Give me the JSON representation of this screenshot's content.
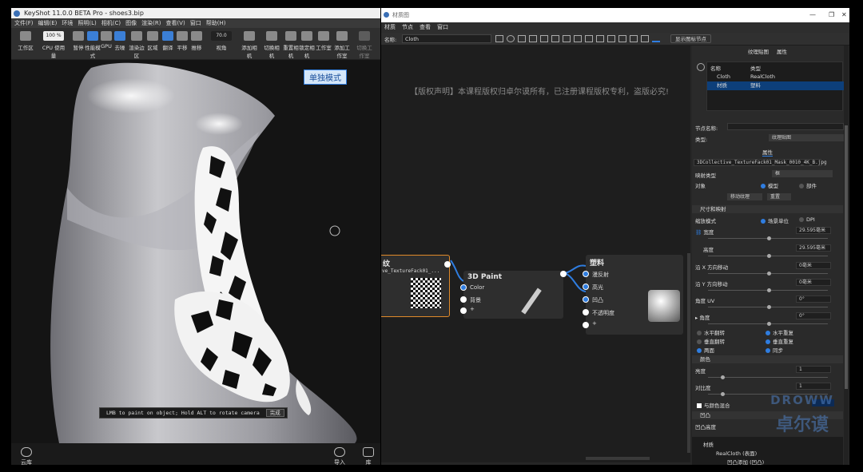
{
  "left_window": {
    "title": "KeyShot 11.0.0 BETA Pro - shoes3.bip",
    "menu": [
      "文件(F)",
      "编辑(E)",
      "环境",
      "照明(L)",
      "相机(C)",
      "图像",
      "渲染(R)",
      "查看(V)",
      "窗口",
      "帮助(H)"
    ],
    "tools": [
      {
        "label": "工作区",
        "value": ""
      },
      {
        "label": "CPU 使用量",
        "value": "100 %"
      },
      {
        "label": "暂停"
      },
      {
        "label": "性能模式"
      },
      {
        "label": "GPU"
      },
      {
        "label": "去噪"
      },
      {
        "label": "渲染边区"
      },
      {
        "label": "区域"
      },
      {
        "label": "翻译"
      },
      {
        "label": "平移"
      },
      {
        "label": "推移"
      },
      {
        "label": "视角",
        "value": "70.0"
      },
      {
        "label": "添加相机"
      },
      {
        "label": "切换相机"
      },
      {
        "label": "重置相机"
      },
      {
        "label": "锁定相机"
      },
      {
        "label": "工作室"
      },
      {
        "label": "添加工作室"
      },
      {
        "label": "切换工作室"
      }
    ],
    "mode_badge": "单独模式",
    "paint_hint": "LMB to paint on object; Hold ALT to rotate camera",
    "paint_done": "完成",
    "bottom": {
      "cloud": "云库",
      "import": "导入",
      "library": "库"
    }
  },
  "right_window": {
    "title": "材质图",
    "menu": [
      "材质",
      "节点",
      "查看",
      "窗口"
    ],
    "name_label": "名称:",
    "name_value": "Cloth",
    "show_node_btn": "显示图标节点",
    "copyright": "【版权声明】本课程版权归卓尔谟所有，已注册课程版权专利，盗版必究!",
    "nodes": {
      "texture": {
        "title": "纹",
        "file": "ve_TextureFack01_..."
      },
      "paint": {
        "title": "3D Paint",
        "inputs": [
          "Color",
          "背景",
          "+"
        ]
      },
      "plastic": {
        "title": "塑料",
        "inputs": [
          "漫反射",
          "高光",
          "凹凸",
          "不透明度",
          "+"
        ]
      }
    }
  },
  "props": {
    "tabs": [
      "纹理贴图",
      "属性"
    ],
    "list_headers": [
      "名称",
      "类型"
    ],
    "list": [
      {
        "name": "Cloth",
        "type": "RealCloth"
      },
      {
        "name": "材质",
        "type": "塑料"
      }
    ],
    "node_name_label": "节点名称:",
    "type_label": "类型:",
    "type_value": "纹理贴图",
    "attr_tab": "属性",
    "file": "3DCollective_TextureFack01_Mask_0010_4K_B.jpg",
    "map_type_label": "映射类型",
    "map_type_value": "框",
    "target_label": "对象",
    "target_opts": [
      "模型",
      "部件"
    ],
    "move_tex_btn": "移动纹理",
    "reset_btn": "重置",
    "size_section": "尺寸和映射",
    "unit_label": "缩放模式",
    "unit_opts": [
      "场景单位",
      "DPI"
    ],
    "width_label": "宽度",
    "width_value": "29.595毫米",
    "height_label": "高度",
    "height_value": "29.595毫米",
    "offx_label": "沿 X 方向移动",
    "offx_value": "0毫米",
    "offy_label": "沿 Y 方向移动",
    "offy_value": "0毫米",
    "angle_uv_label": "角度 UV",
    "angle_uv_value": "0°",
    "angle_label": "角度",
    "angle_value": "0°",
    "flip_h": "水平翻转",
    "flip_v": "垂直翻转",
    "repeat_h": "水平重复",
    "repeat_v": "垂直重复",
    "double": "两面",
    "sync": "同步",
    "color_section": "颜色",
    "brightness_label": "亮度",
    "brightness_value": "1",
    "contrast_label": "对比度",
    "contrast_value": "1",
    "alpha_label": "与颜色混合",
    "bump_section": "凹凸",
    "bump_height_label": "凹凸高度",
    "tree": [
      "材质",
      "RealCloth (表面)",
      "凹凸添加 (凹凸)"
    ]
  },
  "watermark": {
    "en": "DROWW",
    "cn": "卓尔谟"
  }
}
